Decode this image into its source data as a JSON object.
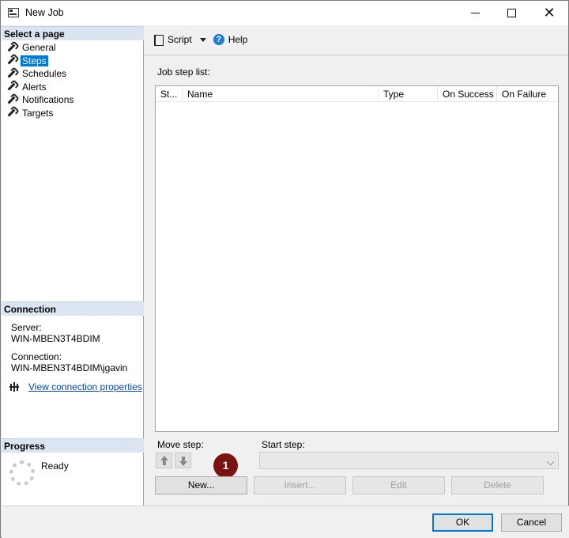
{
  "window": {
    "title": "New Job"
  },
  "left": {
    "select_page_header": "Select a page",
    "pages": [
      {
        "label": "General",
        "selected": false
      },
      {
        "label": "Steps",
        "selected": true
      },
      {
        "label": "Schedules",
        "selected": false
      },
      {
        "label": "Alerts",
        "selected": false
      },
      {
        "label": "Notifications",
        "selected": false
      },
      {
        "label": "Targets",
        "selected": false
      }
    ],
    "connection_header": "Connection",
    "server_label": "Server:",
    "server_value": "WIN-MBEN3T4BDIM",
    "connection_label": "Connection:",
    "connection_value": "WIN-MBEN3T4BDIM\\jgavin",
    "view_connection_link": "View connection properties",
    "progress_header": "Progress",
    "progress_status": "Ready"
  },
  "toolbar": {
    "script_label": "Script",
    "help_label": "Help"
  },
  "steps": {
    "list_label": "Job step list:",
    "columns": [
      "St...",
      "Name",
      "Type",
      "On Success",
      "On Failure"
    ],
    "move_step_label": "Move step:",
    "start_step_label": "Start step:",
    "start_step_value": "",
    "badge": "1",
    "buttons": {
      "new": "New...",
      "insert": "Insert...",
      "edit": "Edit",
      "delete": "Delete"
    }
  },
  "dialog": {
    "ok_label": "OK",
    "cancel_label": "Cancel"
  },
  "colors": {
    "selection": "#0078d7",
    "section_header": "#dbe5f1",
    "badge": "#7a1212",
    "link": "#0645ad"
  }
}
